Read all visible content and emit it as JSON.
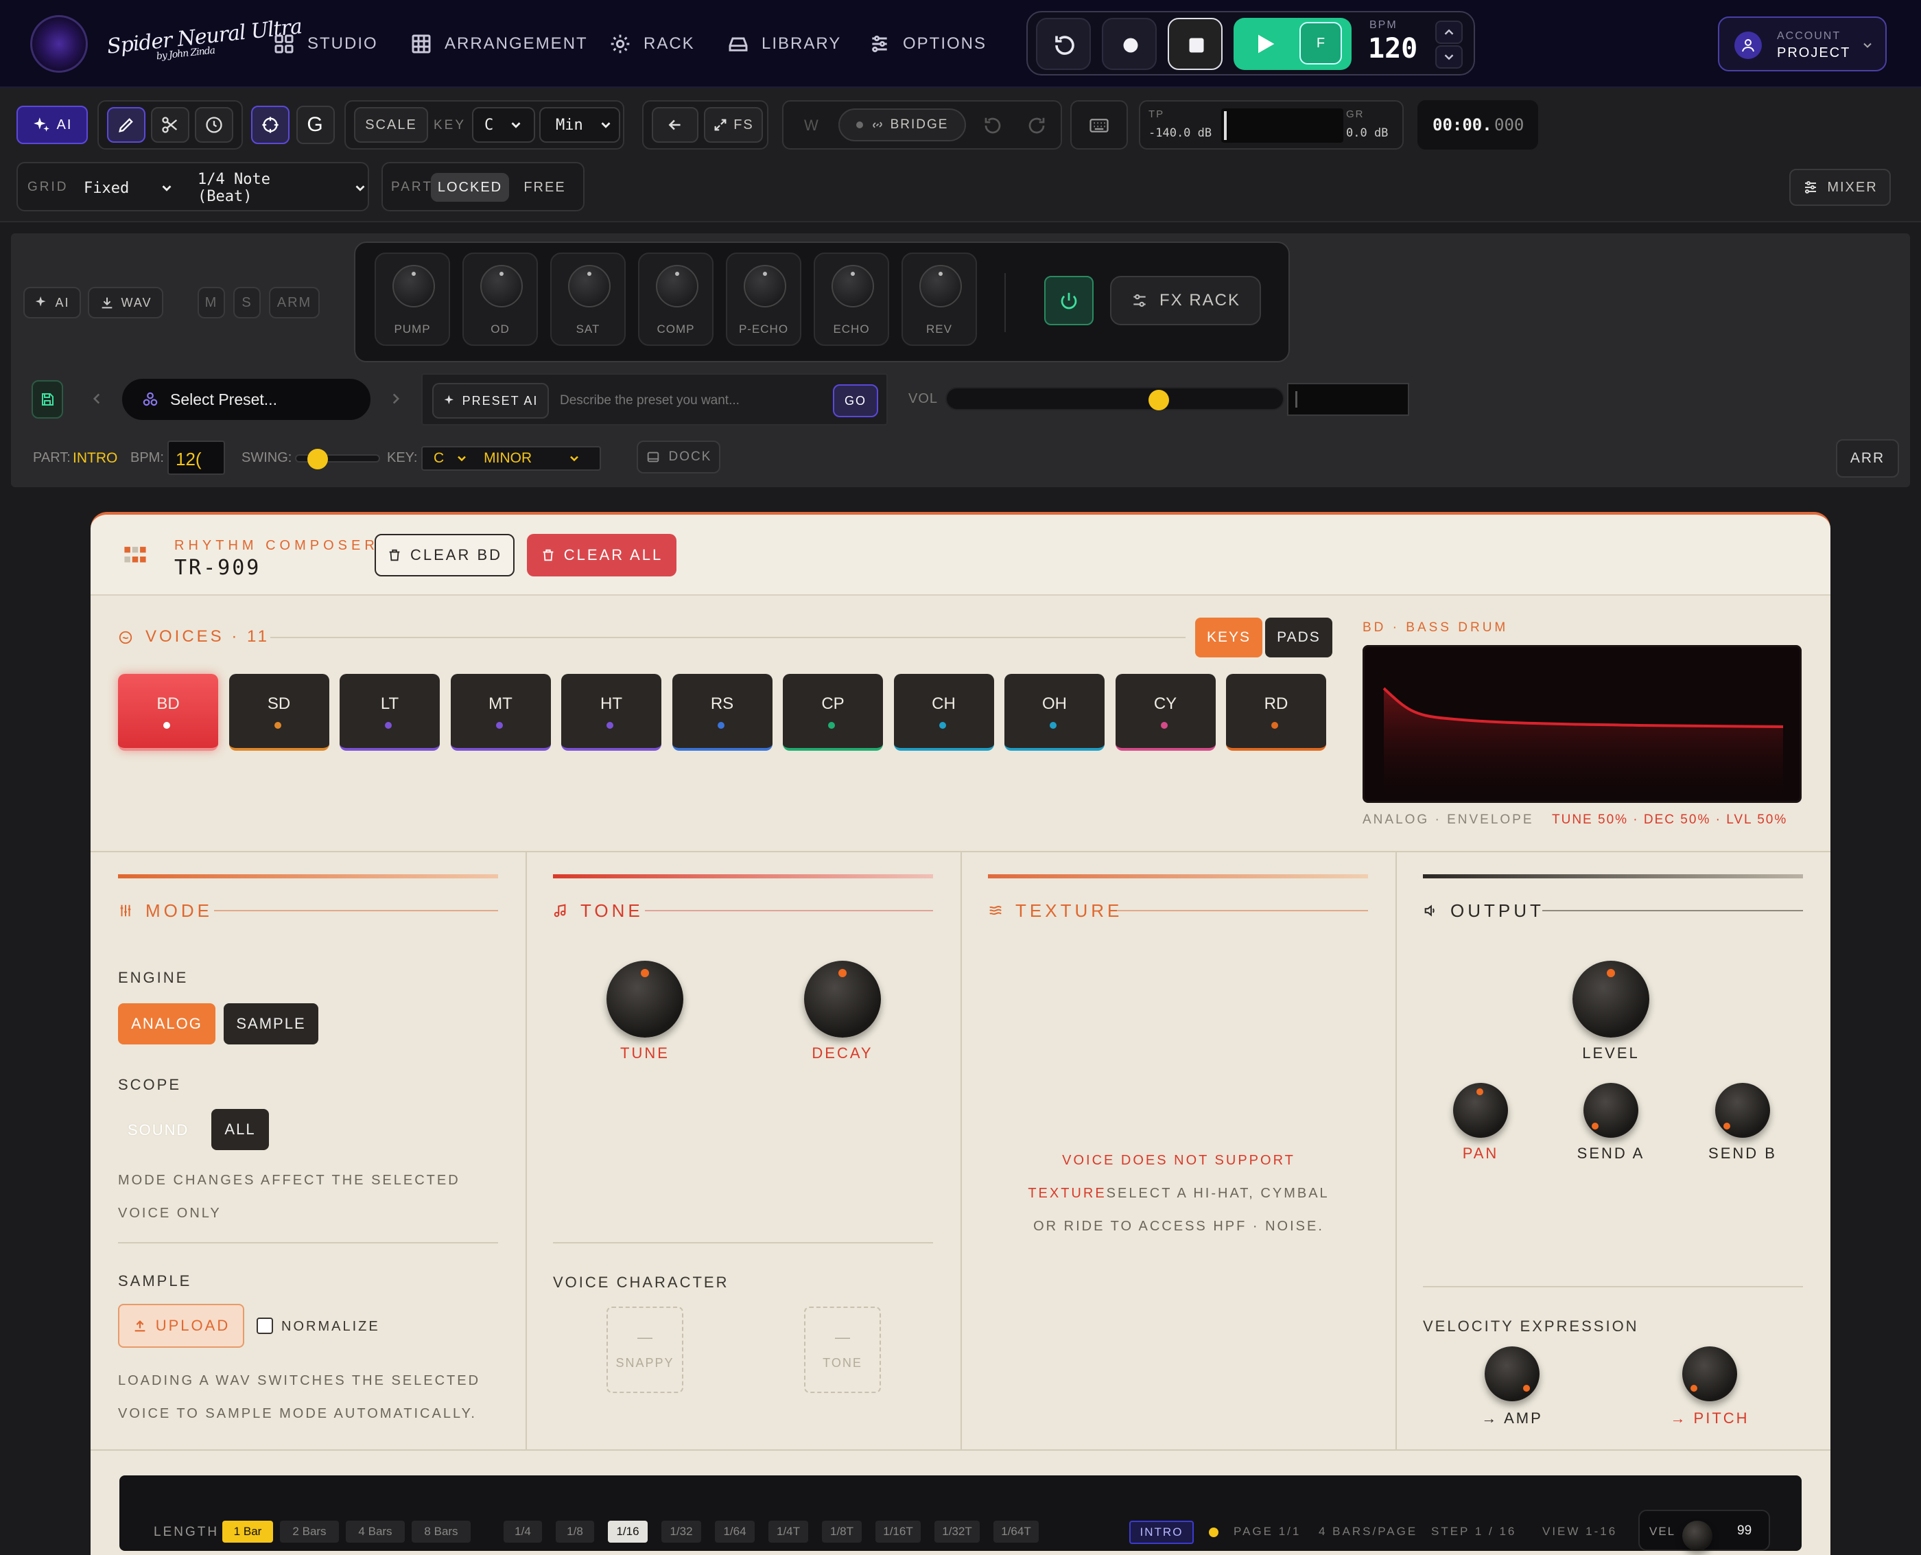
{
  "nav": {
    "brand": "Spider Neural Ultra",
    "brand_sub": "by John Zinda",
    "items": [
      {
        "label": "STUDIO",
        "icon": "grid-icon"
      },
      {
        "label": "ARRANGEMENT",
        "icon": "table-icon"
      },
      {
        "label": "RACK",
        "icon": "gear-icon"
      },
      {
        "label": "LIBRARY",
        "icon": "library-icon"
      },
      {
        "label": "OPTIONS",
        "icon": "sliders-icon"
      }
    ],
    "transport": {
      "f_label": "F",
      "bpm_label": "BPM",
      "bpm": "120"
    },
    "account": {
      "line1": "ACCOUNT",
      "line2": "PROJECT"
    }
  },
  "toolbar": {
    "ai": "AI",
    "g": "G",
    "scale_label": "SCALE",
    "key_label": "KEY",
    "key_value": "C",
    "mode_value": "Min",
    "fs": "FS",
    "w": "W",
    "bridge": "BRIDGE",
    "tp_label": "TP",
    "tp_value": "-140.0 dB",
    "gr_label": "GR",
    "gr_value": "0.0 dB",
    "time": "00:00.",
    "time_ms": "000"
  },
  "row3": {
    "grid_label": "GRID",
    "grid_value": "Fixed",
    "note_value": "1/4 Note (Beat)",
    "part_label": "PART",
    "locked": "LOCKED",
    "free": "FREE",
    "mixer": "MIXER"
  },
  "track": {
    "ai": "AI",
    "wav": "WAV",
    "m": "M",
    "s": "S",
    "arm": "ARM",
    "fx_knobs": [
      "PUMP",
      "OD",
      "SAT",
      "COMP",
      "P-ECHO",
      "ECHO",
      "REV"
    ],
    "fx_rack": "FX RACK",
    "preset_placeholder": "Select Preset...",
    "preset_ai": "PRESET AI",
    "preset_prompt_placeholder": "Describe the preset you want...",
    "go": "GO",
    "vol_label": "VOL",
    "vol_fraction": 0.64,
    "part_label": "PART:",
    "part_value": "INTRO",
    "bpm_label": "BPM:",
    "bpm_value": "12(",
    "swing_label": "SWING:",
    "swing_fraction": 0.18,
    "key_label": "KEY:",
    "key_value": "C",
    "scale_value": "MINOR",
    "dock": "DOCK",
    "arr": "ARR"
  },
  "composer": {
    "kicker": "RHYTHM COMPOSER",
    "title": "TR-909",
    "clear_bd": "CLEAR BD",
    "clear_all": "CLEAR ALL",
    "voices_label": "VOICES · 11",
    "keys": "KEYS",
    "pads": "PADS",
    "voices": [
      {
        "name": "BD",
        "color": "#e8403a"
      },
      {
        "name": "SD",
        "color": "#e0872a"
      },
      {
        "name": "LT",
        "color": "#7b52d6"
      },
      {
        "name": "MT",
        "color": "#7b52d6"
      },
      {
        "name": "HT",
        "color": "#7b52d6"
      },
      {
        "name": "RS",
        "color": "#3a74d8"
      },
      {
        "name": "CP",
        "color": "#1fae72"
      },
      {
        "name": "CH",
        "color": "#1ea0c8"
      },
      {
        "name": "OH",
        "color": "#1ea0c8"
      },
      {
        "name": "CY",
        "color": "#d64a8a"
      },
      {
        "name": "RD",
        "color": "#e06a20"
      }
    ],
    "env_title": "BD · BASS DRUM",
    "env_caption": "ANALOG · ENVELOPE",
    "env_params": "TUNE 50% · DEC 50% · LVL 50%",
    "mode": {
      "title": "MODE",
      "engine_label": "ENGINE",
      "analog": "ANALOG",
      "sample": "SAMPLE",
      "scope_label": "SCOPE",
      "sound": "SOUND",
      "all": "ALL",
      "note": "MODE CHANGES AFFECT THE SELECTED VOICE ONLY",
      "sample_label": "SAMPLE",
      "upload": "UPLOAD",
      "normalize": "NORMALIZE",
      "sample_note": "LOADING A WAV SWITCHES THE SELECTED VOICE TO SAMPLE MODE AUTOMATICALLY."
    },
    "tone": {
      "title": "TONE",
      "tune": "TUNE",
      "decay": "DECAY",
      "character_label": "VOICE CHARACTER",
      "snappy": "SNAPPY",
      "tone_btn": "TONE",
      "dash": "—"
    },
    "texture": {
      "title": "TEXTURE",
      "line1": "VOICE DOES NOT SUPPORT",
      "line2a": "TEXTURE",
      "line2b": "SELECT A HI-HAT, CYMBAL",
      "line3": "OR RIDE TO ACCESS HPF · NOISE."
    },
    "output": {
      "title": "OUTPUT",
      "level": "LEVEL",
      "pan": "PAN",
      "send_a": "SEND A",
      "send_b": "SEND B",
      "velocity_label": "VELOCITY EXPRESSION",
      "amp": "→ AMP",
      "pitch": "→ PITCH"
    },
    "seq": {
      "length_label": "LENGTH",
      "lengths": [
        "1 Bar",
        "2 Bars",
        "4 Bars",
        "8 Bars"
      ],
      "divisions": [
        "1/4",
        "1/8",
        "1/16",
        "1/32",
        "1/64",
        "1/4T",
        "1/8T",
        "1/16T",
        "1/32T",
        "1/64T"
      ],
      "part": "INTRO",
      "page": "PAGE 1/1",
      "bars_page": "4 BARS/PAGE",
      "step": "STEP 1 / 16",
      "view": "VIEW 1-16",
      "vel_label": "VEL",
      "vel_value": "99"
    }
  }
}
